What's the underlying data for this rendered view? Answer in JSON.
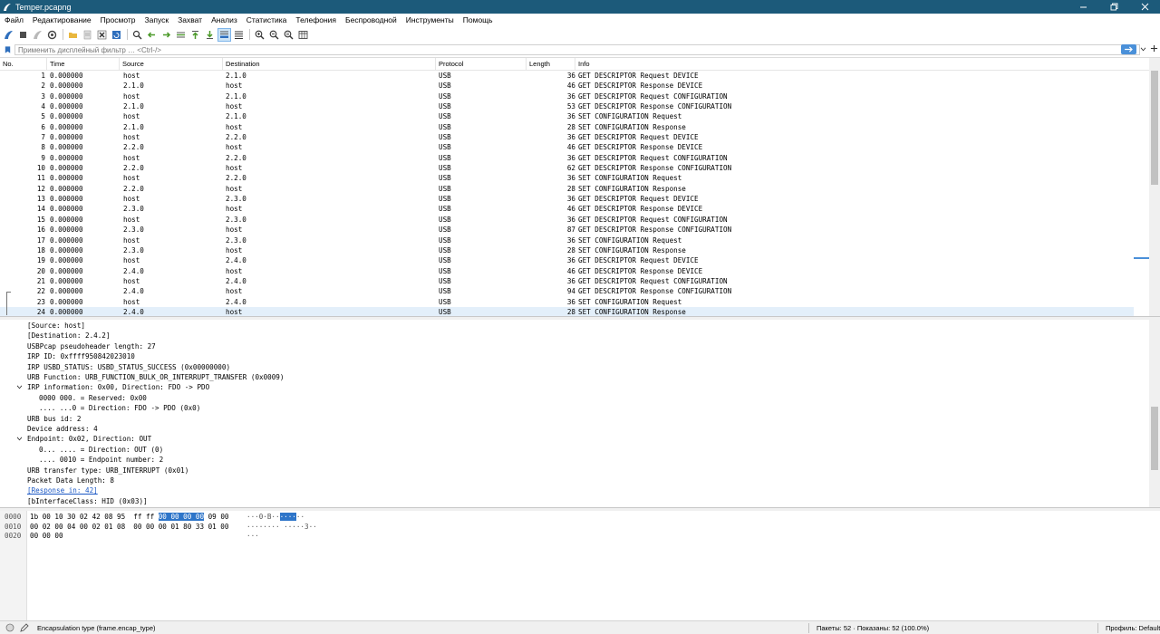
{
  "window": {
    "title": "Temper.pcapng"
  },
  "menu": [
    "Файл",
    "Редактирование",
    "Просмотр",
    "Запуск",
    "Захват",
    "Анализ",
    "Статистика",
    "Телефония",
    "Беспроводной",
    "Инструменты",
    "Помощь"
  ],
  "filter": {
    "placeholder": "Применить дисплейный фильтр … <Ctrl-/>"
  },
  "columns": {
    "no": "No.",
    "time": "Time",
    "source": "Source",
    "destination": "Destination",
    "protocol": "Protocol",
    "length": "Length",
    "info": "Info"
  },
  "packets": [
    {
      "no": "1",
      "time": "0.000000",
      "src": "host",
      "dst": "2.1.0",
      "proto": "USB",
      "len": "36",
      "info": "GET DESCRIPTOR Request DEVICE"
    },
    {
      "no": "2",
      "time": "0.000000",
      "src": "2.1.0",
      "dst": "host",
      "proto": "USB",
      "len": "46",
      "info": "GET DESCRIPTOR Response DEVICE"
    },
    {
      "no": "3",
      "time": "0.000000",
      "src": "host",
      "dst": "2.1.0",
      "proto": "USB",
      "len": "36",
      "info": "GET DESCRIPTOR Request CONFIGURATION"
    },
    {
      "no": "4",
      "time": "0.000000",
      "src": "2.1.0",
      "dst": "host",
      "proto": "USB",
      "len": "53",
      "info": "GET DESCRIPTOR Response CONFIGURATION"
    },
    {
      "no": "5",
      "time": "0.000000",
      "src": "host",
      "dst": "2.1.0",
      "proto": "USB",
      "len": "36",
      "info": "SET CONFIGURATION Request"
    },
    {
      "no": "6",
      "time": "0.000000",
      "src": "2.1.0",
      "dst": "host",
      "proto": "USB",
      "len": "28",
      "info": "SET CONFIGURATION Response"
    },
    {
      "no": "7",
      "time": "0.000000",
      "src": "host",
      "dst": "2.2.0",
      "proto": "USB",
      "len": "36",
      "info": "GET DESCRIPTOR Request DEVICE"
    },
    {
      "no": "8",
      "time": "0.000000",
      "src": "2.2.0",
      "dst": "host",
      "proto": "USB",
      "len": "46",
      "info": "GET DESCRIPTOR Response DEVICE"
    },
    {
      "no": "9",
      "time": "0.000000",
      "src": "host",
      "dst": "2.2.0",
      "proto": "USB",
      "len": "36",
      "info": "GET DESCRIPTOR Request CONFIGURATION"
    },
    {
      "no": "10",
      "time": "0.000000",
      "src": "2.2.0",
      "dst": "host",
      "proto": "USB",
      "len": "62",
      "info": "GET DESCRIPTOR Response CONFIGURATION"
    },
    {
      "no": "11",
      "time": "0.000000",
      "src": "host",
      "dst": "2.2.0",
      "proto": "USB",
      "len": "36",
      "info": "SET CONFIGURATION Request"
    },
    {
      "no": "12",
      "time": "0.000000",
      "src": "2.2.0",
      "dst": "host",
      "proto": "USB",
      "len": "28",
      "info": "SET CONFIGURATION Response"
    },
    {
      "no": "13",
      "time": "0.000000",
      "src": "host",
      "dst": "2.3.0",
      "proto": "USB",
      "len": "36",
      "info": "GET DESCRIPTOR Request DEVICE"
    },
    {
      "no": "14",
      "time": "0.000000",
      "src": "2.3.0",
      "dst": "host",
      "proto": "USB",
      "len": "46",
      "info": "GET DESCRIPTOR Response DEVICE"
    },
    {
      "no": "15",
      "time": "0.000000",
      "src": "host",
      "dst": "2.3.0",
      "proto": "USB",
      "len": "36",
      "info": "GET DESCRIPTOR Request CONFIGURATION"
    },
    {
      "no": "16",
      "time": "0.000000",
      "src": "2.3.0",
      "dst": "host",
      "proto": "USB",
      "len": "87",
      "info": "GET DESCRIPTOR Response CONFIGURATION"
    },
    {
      "no": "17",
      "time": "0.000000",
      "src": "host",
      "dst": "2.3.0",
      "proto": "USB",
      "len": "36",
      "info": "SET CONFIGURATION Request"
    },
    {
      "no": "18",
      "time": "0.000000",
      "src": "2.3.0",
      "dst": "host",
      "proto": "USB",
      "len": "28",
      "info": "SET CONFIGURATION Response"
    },
    {
      "no": "19",
      "time": "0.000000",
      "src": "host",
      "dst": "2.4.0",
      "proto": "USB",
      "len": "36",
      "info": "GET DESCRIPTOR Request DEVICE"
    },
    {
      "no": "20",
      "time": "0.000000",
      "src": "2.4.0",
      "dst": "host",
      "proto": "USB",
      "len": "46",
      "info": "GET DESCRIPTOR Response DEVICE"
    },
    {
      "no": "21",
      "time": "0.000000",
      "src": "host",
      "dst": "2.4.0",
      "proto": "USB",
      "len": "36",
      "info": "GET DESCRIPTOR Request CONFIGURATION"
    },
    {
      "no": "22",
      "time": "0.000000",
      "src": "2.4.0",
      "dst": "host",
      "proto": "USB",
      "len": "94",
      "info": "GET DESCRIPTOR Response CONFIGURATION"
    },
    {
      "no": "23",
      "time": "0.000000",
      "src": "host",
      "dst": "2.4.0",
      "proto": "USB",
      "len": "36",
      "info": "SET CONFIGURATION Request"
    },
    {
      "no": "24",
      "time": "0.000000",
      "src": "2.4.0",
      "dst": "host",
      "proto": "USB",
      "len": "28",
      "info": "SET CONFIGURATION Response"
    }
  ],
  "details": [
    {
      "text": "[Source: host]",
      "indent": 0
    },
    {
      "text": "[Destination: 2.4.2]",
      "indent": 0
    },
    {
      "text": "USBPcap pseudoheader length: 27",
      "indent": 0
    },
    {
      "text": "IRP ID: 0xffff950842023010",
      "indent": 0
    },
    {
      "text": "IRP USBD_STATUS: USBD_STATUS_SUCCESS (0x00000000)",
      "indent": 0
    },
    {
      "text": "URB Function: URB_FUNCTION_BULK_OR_INTERRUPT_TRANSFER (0x0009)",
      "indent": 0
    },
    {
      "text": "IRP information: 0x00, Direction: FDO -> PDO",
      "indent": 0,
      "expanded": true
    },
    {
      "text": "0000 000. = Reserved: 0x00",
      "indent": 1
    },
    {
      "text": ".... ...0 = Direction: FDO -> PDO (0x0)",
      "indent": 1
    },
    {
      "text": "URB bus id: 2",
      "indent": 0
    },
    {
      "text": "Device address: 4",
      "indent": 0
    },
    {
      "text": "Endpoint: 0x02, Direction: OUT",
      "indent": 0,
      "expanded": true
    },
    {
      "text": "0... .... = Direction: OUT (0)",
      "indent": 1
    },
    {
      "text": ".... 0010 = Endpoint number: 2",
      "indent": 1
    },
    {
      "text": "URB transfer type: URB_INTERRUPT (0x01)",
      "indent": 0
    },
    {
      "text": "Packet Data Length: 8",
      "indent": 0
    },
    {
      "text": "[Response in: 42]",
      "indent": 0,
      "link": true
    },
    {
      "text": "[bInterfaceClass: HID (0x03)]",
      "indent": 0
    }
  ],
  "bytes": [
    {
      "offset": "0000",
      "hex_pre": "1b 00 10 30 02 42 08 95  ff ff ",
      "hex_hl": "00 00 00 00",
      "hex_post": " 09 00",
      "ascii_pre": "···0·B··",
      "ascii_hl": "····",
      "ascii_post": "··"
    },
    {
      "offset": "0010",
      "hex_pre": "00 02 00 04 00 02 01 08  00 00 00 01 80 33 01 00",
      "hex_hl": "",
      "hex_post": "",
      "ascii_pre": "········ ·····3··",
      "ascii_hl": "",
      "ascii_post": ""
    },
    {
      "offset": "0020",
      "hex_pre": "00 00 00",
      "hex_hl": "",
      "hex_post": "",
      "ascii_pre": "···",
      "ascii_hl": "",
      "ascii_post": ""
    }
  ],
  "status": {
    "field": "Encapsulation type (frame.encap_type)",
    "packets": "Пакеты: 52 · Показаны: 52 (100.0%)",
    "profile": "Профиль: Default"
  },
  "colors": {
    "titlebar": "#1c5a7a",
    "selected_row": "#e3effa",
    "highlight": "#2e75c9",
    "link": "#1a57c4"
  }
}
